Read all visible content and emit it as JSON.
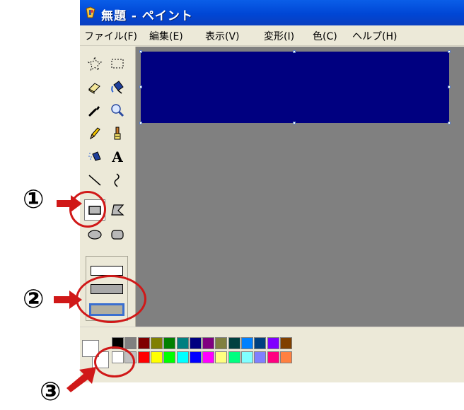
{
  "window": {
    "title": "無題 - ペイント",
    "menu": [
      "ファイル(F)",
      "編集(E)",
      "表示(V)",
      "変形(I)",
      "色(C)",
      "ヘルプ(H)"
    ]
  },
  "tools": [
    {
      "name": "free-select-tool",
      "icon": "star-dashed-icon"
    },
    {
      "name": "rect-select-tool",
      "icon": "dashed-rectangle-icon"
    },
    {
      "name": "eraser-tool",
      "icon": "eraser-icon"
    },
    {
      "name": "fill-tool",
      "icon": "paint-bucket-icon"
    },
    {
      "name": "color-picker-tool",
      "icon": "eyedropper-icon"
    },
    {
      "name": "magnifier-tool",
      "icon": "magnifier-icon"
    },
    {
      "name": "pencil-tool",
      "icon": "pencil-icon"
    },
    {
      "name": "brush-tool",
      "icon": "brush-icon"
    },
    {
      "name": "airbrush-tool",
      "icon": "airbrush-icon"
    },
    {
      "name": "text-tool",
      "icon": "text-icon",
      "label": "A"
    },
    {
      "name": "line-tool",
      "icon": "line-icon"
    },
    {
      "name": "curve-tool",
      "icon": "curve-icon"
    },
    {
      "name": "rectangle-tool",
      "icon": "rectangle-icon",
      "selected": true
    },
    {
      "name": "polygon-tool",
      "icon": "polygon-icon"
    },
    {
      "name": "ellipse-tool",
      "icon": "ellipse-icon"
    },
    {
      "name": "rounded-rectangle-tool",
      "icon": "rounded-rectangle-icon"
    }
  ],
  "fill_options": [
    "outline-only",
    "outline-and-fill",
    "fill-only"
  ],
  "canvas": {
    "shape_color": "#000080",
    "background": "#808080"
  },
  "palette": {
    "top_row": [
      "#000000",
      "#808080",
      "#800000",
      "#808000",
      "#008000",
      "#008080",
      "#000080",
      "#800080",
      "#808040",
      "#004040",
      "#0080ff",
      "#004080",
      "#8000ff",
      "#804000"
    ],
    "bottom_row": [
      "#ffffff",
      "#c0c0c0",
      "#ff0000",
      "#ffff00",
      "#00ff00",
      "#00ffff",
      "#0000ff",
      "#ff00ff",
      "#ffff80",
      "#00ff80",
      "#80ffff",
      "#8080ff",
      "#ff0080",
      "#ff8040"
    ]
  },
  "annotations": {
    "marker_1": "①",
    "marker_2": "②",
    "marker_3": "③",
    "color": "#d01818"
  }
}
